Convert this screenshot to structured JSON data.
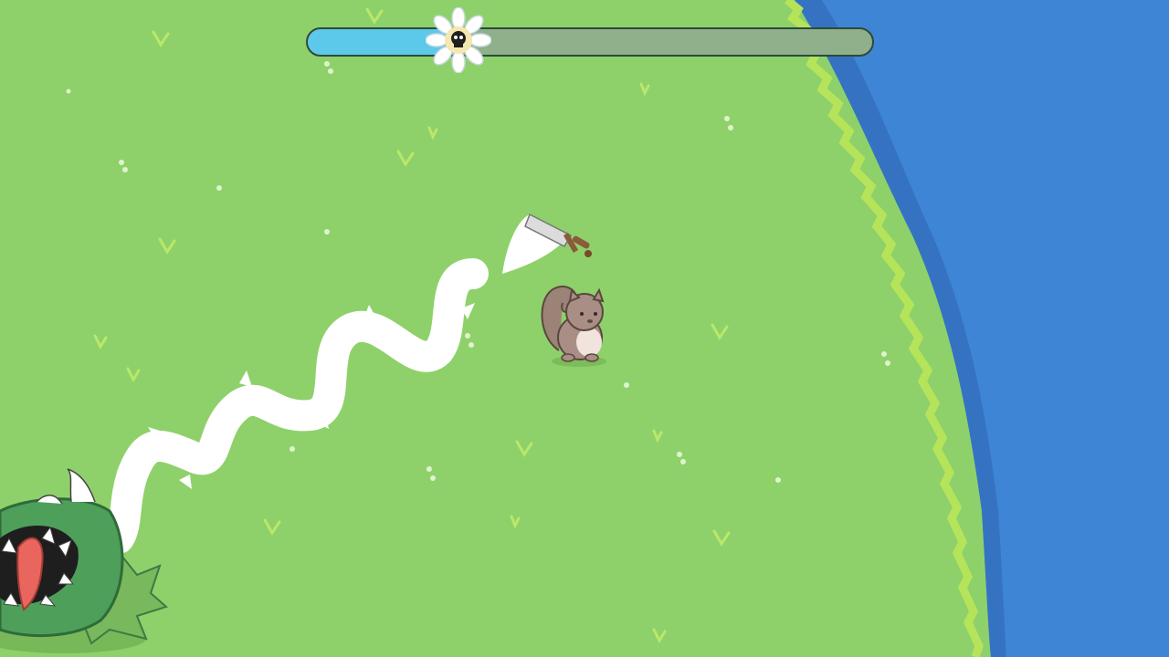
{
  "hud": {
    "boss_progress": 0.27,
    "boss_marker_icon": "daisy-skull-icon"
  },
  "scene": {
    "player": "squirrel",
    "weapon": "sword",
    "enemy": "carnivorous-plant",
    "enemy_attack": "thorny-vine",
    "colors": {
      "grass": "#8ed16a",
      "grass_edge": "#b5e45a",
      "water": "#3e85d6",
      "progress_fill": "#5cc9ea",
      "progress_track": "#8fb08a"
    }
  }
}
